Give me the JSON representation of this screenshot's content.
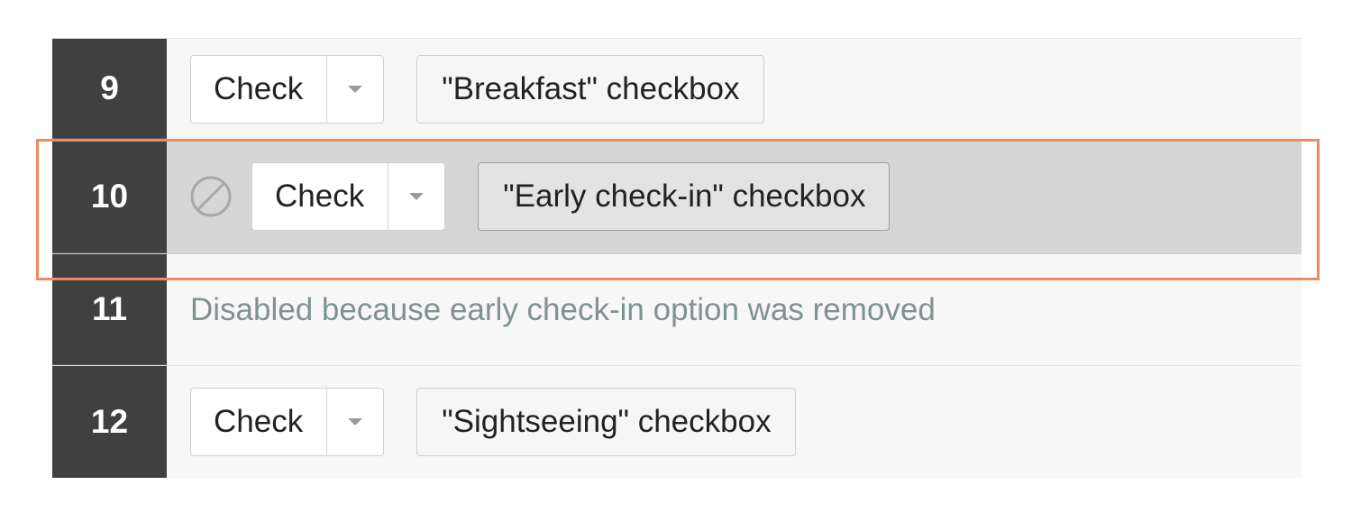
{
  "steps": [
    {
      "number": "9",
      "action": "Check",
      "target": "\"Breakfast\" checkbox"
    },
    {
      "number": "10",
      "disabled": true,
      "action": "Check",
      "target": "\"Early check-in\" checkbox"
    },
    {
      "number": "11",
      "comment": "Disabled because early check-in option was removed"
    },
    {
      "number": "12",
      "action": "Check",
      "target": "\"Sightseeing\" checkbox"
    }
  ],
  "colors": {
    "row_number_bg": "#404040",
    "selected_row_bg": "#d6d6d6",
    "highlight_border": "#ee8a64",
    "comment_text": "#7e9292"
  },
  "icons": {
    "disabled": "disabled-circle-slash-icon",
    "dropdown": "caret-down-icon"
  }
}
